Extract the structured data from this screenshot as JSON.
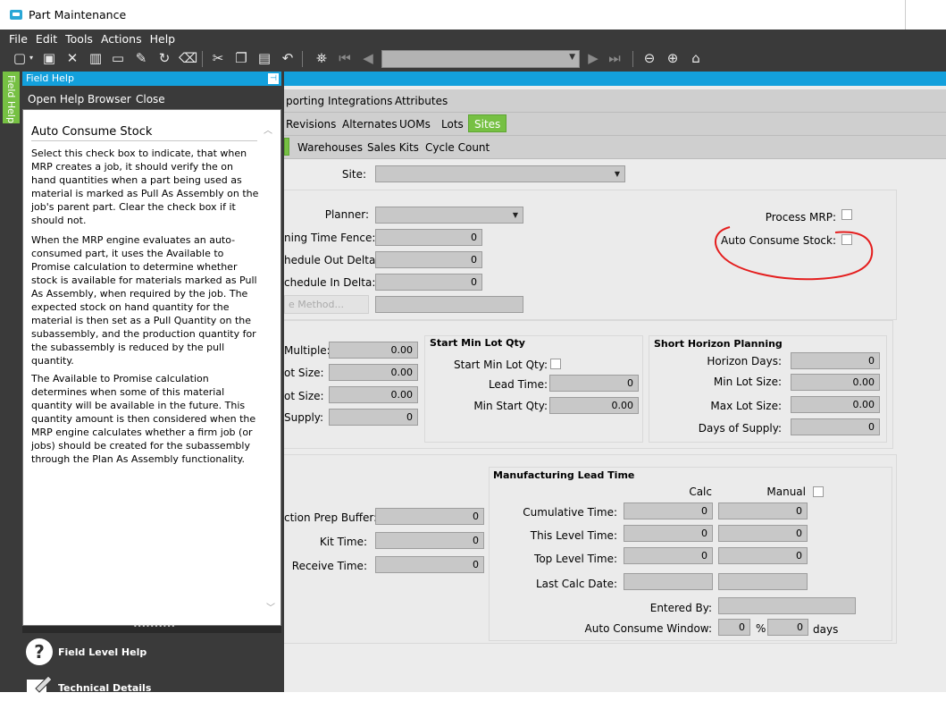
{
  "window": {
    "title": "Part Maintenance"
  },
  "menu": [
    "File",
    "Edit",
    "Tools",
    "Actions",
    "Help"
  ],
  "field_help": {
    "tab_label": "Field Help",
    "title": "Field Help",
    "links": {
      "open_browser": "Open Help Browser",
      "close": "Close"
    },
    "heading": "Auto Consume Stock",
    "paragraphs": [
      "Select this check box to indicate, that when MRP creates a job, it should verify the on hand quantities when a part being used as material is marked as Pull As Assembly on the job's parent part. Clear the check box if it should not.",
      "When the MRP engine evaluates an auto-consumed part, it uses the Available to Promise calculation to determine whether stock is available for materials marked as Pull As Assembly, when required by the job. The expected stock on hand quantity for the material is then set as a Pull Quantity on the subassembly, and the production quantity for the subassembly is reduced by the pull quantity.",
      "The Available to Promise calculation determines when some of this material quantity will be available in the future. This quantity amount is then considered when the MRP engine calculates whether a firm job (or jobs) should be created for the subassembly through the Plan As Assembly functionality."
    ],
    "bottom": {
      "field_level_help": "Field Level Help",
      "technical_details": "Technical Details"
    }
  },
  "tabs": {
    "row1": [
      "porting",
      "Integrations",
      "Attributes"
    ],
    "row2": [
      "Revisions",
      "Alternates",
      "UOMs",
      "Lots",
      "Sites"
    ],
    "row3": [
      "Warehouses",
      "Sales Kits",
      "Cycle Count"
    ]
  },
  "form": {
    "site_label": "Site:",
    "planner_label": "Planner:",
    "planning_time_fence_label": "ning Time Fence:",
    "planning_time_fence": "0",
    "schedule_out_delta_label": "hedule Out Delta:",
    "schedule_out_delta": "0",
    "schedule_in_delta_label": "chedule In Delta:",
    "schedule_in_delta": "0",
    "method_button": "e Method...",
    "process_mrp_label": "Process MRP:",
    "auto_consume_stock_label": "Auto Consume Stock:",
    "multiple_label": "Multiple:",
    "multiple": "0.00",
    "lot_size_label": "ot Size:",
    "lot_size": "0.00",
    "lot_size2_label": "ot Size:",
    "lot_size2": "0.00",
    "supply_label": "Supply:",
    "supply": "0",
    "start_min_lot": {
      "title": "Start Min Lot Qty",
      "chk_label": "Start Min Lot Qty:",
      "lead_time_label": "Lead Time:",
      "lead_time": "0",
      "min_start_qty_label": "Min Start Qty:",
      "min_start_qty": "0.00"
    },
    "short_horizon": {
      "title": "Short Horizon Planning",
      "horizon_days_label": "Horizon Days:",
      "horizon_days": "0",
      "min_lot_size_label": "Min Lot Size:",
      "min_lot_size": "0.00",
      "max_lot_size_label": "Max Lot Size:",
      "max_lot_size": "0.00",
      "days_of_supply_label": "Days of Supply:",
      "days_of_supply": "0"
    },
    "production_prep_buffer_label": "ction Prep Buffer:",
    "production_prep_buffer": "0",
    "kit_time_label": "Kit Time:",
    "kit_time": "0",
    "receive_time_label": "Receive Time:",
    "receive_time": "0",
    "mfg_lead_time": {
      "title": "Manufacturing Lead Time",
      "calc_header": "Calc",
      "manual_header": "Manual",
      "cumulative_label": "Cumulative Time:",
      "cumulative_calc": "0",
      "cumulative_manual": "0",
      "this_level_label": "This Level Time:",
      "this_level_calc": "0",
      "this_level_manual": "0",
      "top_level_label": "Top Level Time:",
      "top_level_calc": "0",
      "top_level_manual": "0",
      "last_calc_date_label": "Last Calc Date:",
      "entered_by_label": "Entered By:",
      "auto_consume_window_label": "Auto Consume Window:",
      "auto_consume_window_pct": "0",
      "pct_symbol": "%",
      "auto_consume_window_days": "0",
      "days_label": "days"
    }
  },
  "colors": {
    "accent_blue": "#13a0dc",
    "active_tab_green": "#76c043",
    "annotation_red": "#e41e1e",
    "chrome_dark": "#3a3a3a"
  }
}
